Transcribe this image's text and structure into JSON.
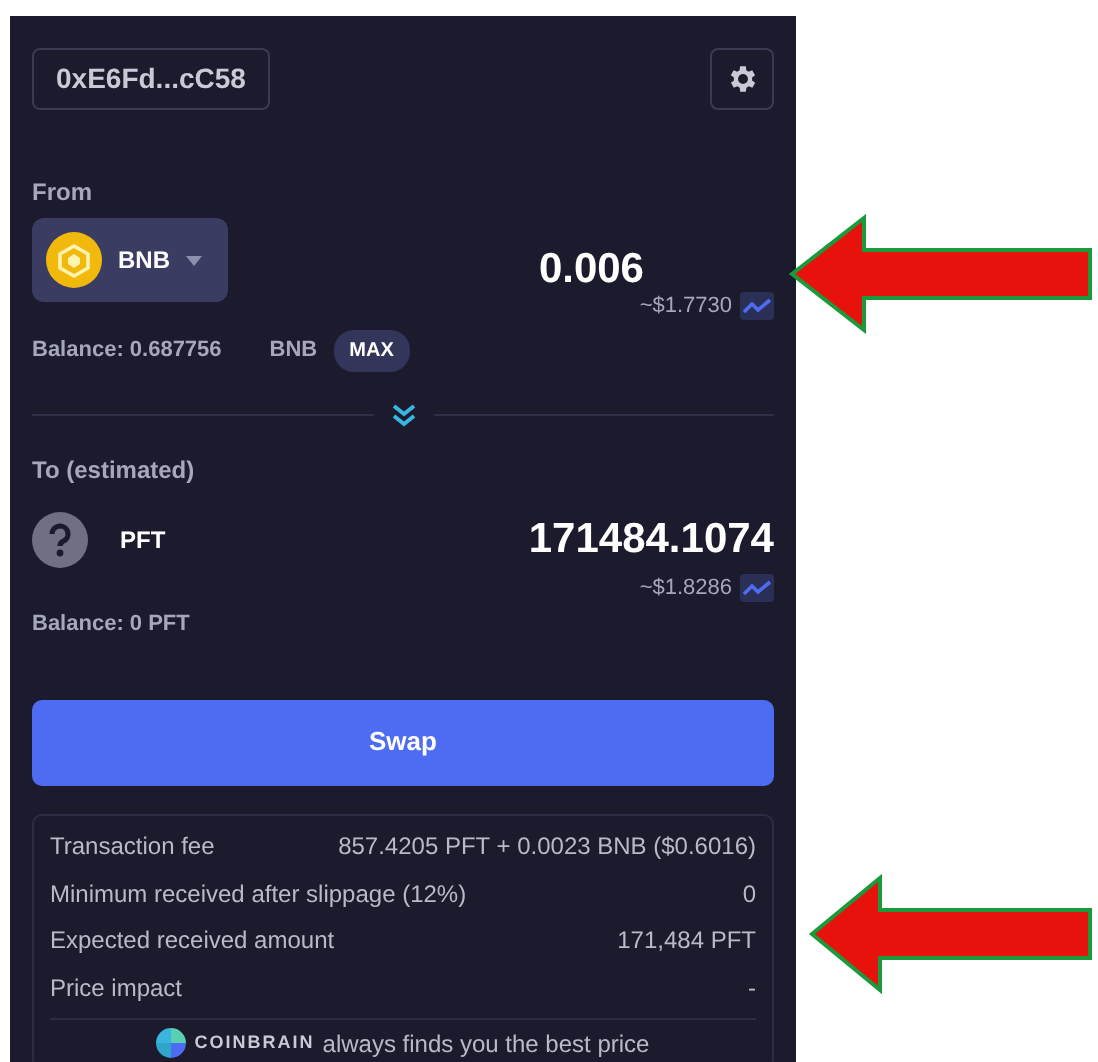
{
  "wallet": {
    "address": "0xE6Fd...cC58"
  },
  "from": {
    "label": "From",
    "token": "BNB",
    "amount": "0.006",
    "usd": "~$1.7730",
    "balance": "Balance: 0.687756",
    "balance_unit": "BNB",
    "max": "MAX"
  },
  "to": {
    "label": "To (estimated)",
    "token": "PFT",
    "amount": "171484.1074",
    "usd": "~$1.8286",
    "balance": "Balance: 0 PFT"
  },
  "swap_button": "Swap",
  "details": [
    {
      "label": "Transaction fee",
      "value": "857.4205 PFT + 0.0023 BNB ($0.6016)"
    },
    {
      "label": "Minimum received after slippage (12%)",
      "value": "0"
    },
    {
      "label": "Expected received amount",
      "value": "171,484 PFT"
    },
    {
      "label": "Price impact",
      "value": "-"
    }
  ],
  "footer": {
    "brand": "COINBRAIN",
    "text": "always finds you the best price"
  }
}
